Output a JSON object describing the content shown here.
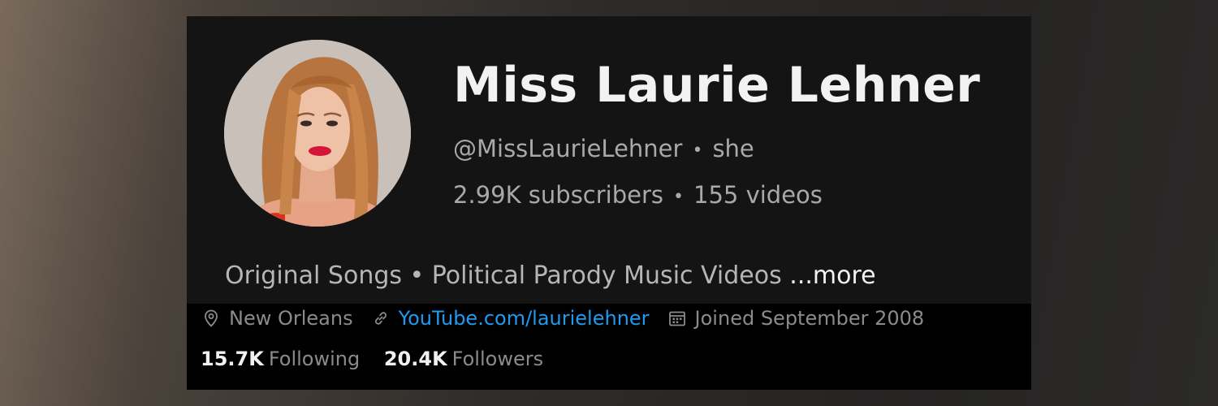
{
  "profile": {
    "name": "Miss Laurie Lehner",
    "handle": "@MissLaurieLehner",
    "pronouns": "she",
    "subscribers": "2.99K subscribers",
    "videos": "155 videos",
    "separator": "•",
    "bio": "Original Songs • Political Parody Music Videos",
    "more_label": "...more"
  },
  "meta": {
    "location": "New Orleans",
    "website": "YouTube.com/laurielehner",
    "joined": "Joined September 2008",
    "link_color": "#1d9bf0"
  },
  "stats": {
    "following_count": "15.7K",
    "following_label": "Following",
    "followers_count": "20.4K",
    "followers_label": "Followers"
  },
  "icons": {
    "location": "location-pin-icon",
    "website": "link-icon",
    "joined": "calendar-icon"
  }
}
